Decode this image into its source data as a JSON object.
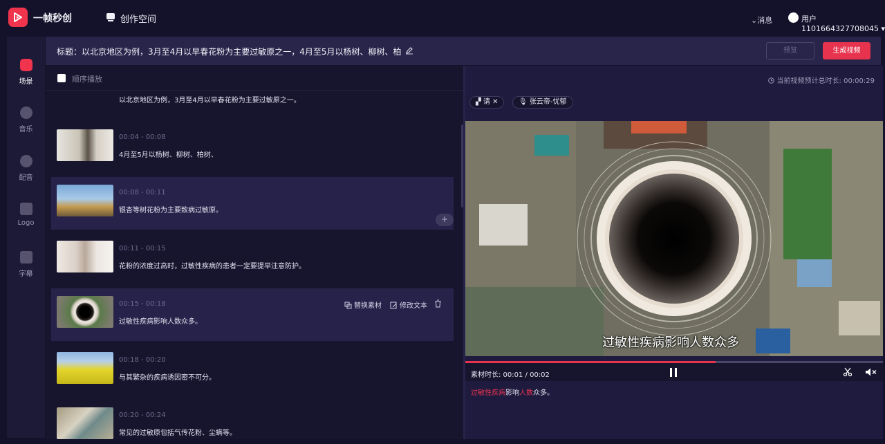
{
  "app": {
    "brand": "一帧秒创",
    "workspace": "创作空间",
    "messages": "消息",
    "user": "用户110166432770804​5"
  },
  "nav": [
    {
      "label": "场景",
      "icon": "scene-icon",
      "active": true
    },
    {
      "label": "音乐",
      "icon": "music-icon"
    },
    {
      "label": "配音",
      "icon": "voiceover-icon"
    },
    {
      "label": "Logo",
      "icon": "logo-icon"
    },
    {
      "label": "字幕",
      "icon": "subtitle-icon"
    }
  ],
  "title": {
    "text": "标题：以北京地区为例，3月至4月以早春花粉为主要过敏原之一，4月至5月以杨树、柳树、柏",
    "preview_button": "预览",
    "generate_button": "生成视频"
  },
  "scene_list": {
    "sequential_play": "顺序播放",
    "scenes": [
      {
        "time": "",
        "text": "以北京地区为例，3月至4月以早春花粉为主要过敏原之一。"
      },
      {
        "time": "00:04 - 00:08",
        "text": "4月至5月以杨树、柳树、柏树、"
      },
      {
        "time": "00:08 - 00:11",
        "text": "银杏等树花粉为主要致病过敏原。"
      },
      {
        "time": "00:11 - 00:15",
        "text": "花粉的浓度过高时，过敏性疾病的患者一定要提早注意防护。"
      },
      {
        "time": "00:15 - 00:18",
        "text": "过敏性疾病影响人数众多。"
      },
      {
        "time": "00:18 - 00:20",
        "text": "与其繁杂的疾病诱因密不可分。"
      },
      {
        "time": "00:20 - 00:24",
        "text": "常见的过敏原包括气传花粉、尘螨等。"
      }
    ],
    "add_label": "+",
    "replace_material": "替换素材",
    "edit_text": "修改文本"
  },
  "preview": {
    "estimated_duration": "当前视频预计总时长: 00:00:29",
    "tag_label": "请",
    "voice_label": "张云帝-忧郁",
    "subtitle": "过敏性疾病影响人数众多",
    "material_duration": "素材时长: 00:01 / 00:02",
    "progress": 0.6,
    "caption_parts": [
      {
        "text": "过敏性疾病",
        "red": true
      },
      {
        "text": "影响",
        "red": false
      },
      {
        "text": "人数",
        "red": true
      },
      {
        "text": "众多。",
        "red": false
      }
    ]
  }
}
